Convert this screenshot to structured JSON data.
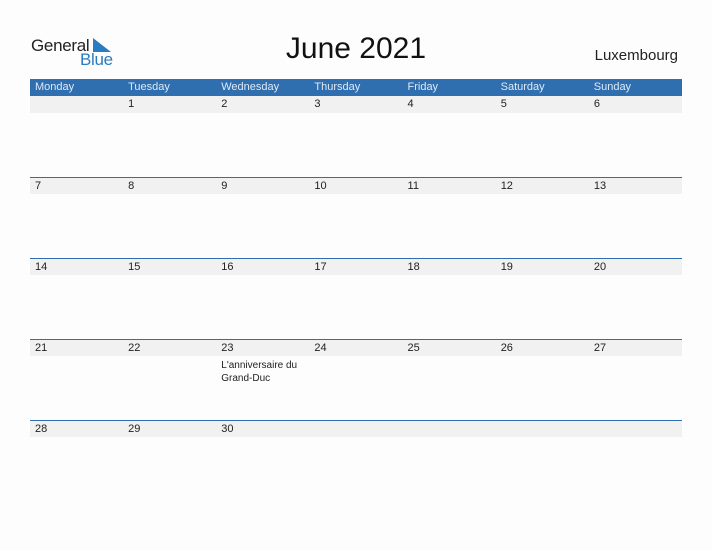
{
  "logo": {
    "general": "General",
    "blue": "Blue"
  },
  "title": "June 2021",
  "country": "Luxembourg",
  "accent": "#2f6fb0",
  "weekdays": [
    "Monday",
    "Tuesday",
    "Wednesday",
    "Thursday",
    "Friday",
    "Saturday",
    "Sunday"
  ],
  "weeks": [
    [
      "",
      "1",
      "2",
      "3",
      "4",
      "5",
      "6"
    ],
    [
      "7",
      "8",
      "9",
      "10",
      "11",
      "12",
      "13"
    ],
    [
      "14",
      "15",
      "16",
      "17",
      "18",
      "19",
      "20"
    ],
    [
      "21",
      "22",
      "23",
      "24",
      "25",
      "26",
      "27"
    ],
    [
      "28",
      "29",
      "30",
      "",
      "",
      "",
      ""
    ]
  ],
  "events": [
    {
      "week": 3,
      "day": 2,
      "text": "L'anniversaire du Grand-Duc"
    }
  ]
}
